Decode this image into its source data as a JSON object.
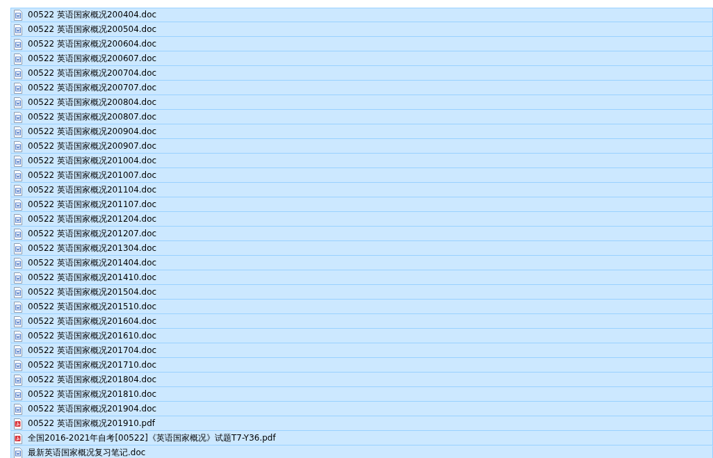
{
  "files": [
    {
      "name": "00522 英语国家概况200404.doc",
      "kind": "doc",
      "selected": true
    },
    {
      "name": "00522 英语国家概况200504.doc",
      "kind": "doc",
      "selected": true
    },
    {
      "name": "00522 英语国家概况200604.doc",
      "kind": "doc",
      "selected": true
    },
    {
      "name": "00522 英语国家概况200607.doc",
      "kind": "doc",
      "selected": true
    },
    {
      "name": "00522 英语国家概况200704.doc",
      "kind": "doc",
      "selected": true
    },
    {
      "name": "00522 英语国家概况200707.doc",
      "kind": "doc",
      "selected": true
    },
    {
      "name": "00522 英语国家概况200804.doc",
      "kind": "doc",
      "selected": true
    },
    {
      "name": "00522 英语国家概况200807.doc",
      "kind": "doc",
      "selected": true
    },
    {
      "name": "00522 英语国家概况200904.doc",
      "kind": "doc",
      "selected": true
    },
    {
      "name": "00522 英语国家概况200907.doc",
      "kind": "doc",
      "selected": true
    },
    {
      "name": "00522 英语国家概况201004.doc",
      "kind": "doc",
      "selected": true
    },
    {
      "name": "00522 英语国家概况201007.doc",
      "kind": "doc",
      "selected": true
    },
    {
      "name": "00522 英语国家概况201104.doc",
      "kind": "doc",
      "selected": true
    },
    {
      "name": "00522 英语国家概况201107.doc",
      "kind": "doc",
      "selected": true
    },
    {
      "name": "00522 英语国家概况201204.doc",
      "kind": "doc",
      "selected": true
    },
    {
      "name": "00522 英语国家概况201207.doc",
      "kind": "doc",
      "selected": true
    },
    {
      "name": "00522 英语国家概况201304.doc",
      "kind": "doc",
      "selected": true
    },
    {
      "name": "00522 英语国家概况201404.doc",
      "kind": "doc",
      "selected": true
    },
    {
      "name": "00522 英语国家概况201410.doc",
      "kind": "doc",
      "selected": true
    },
    {
      "name": "00522 英语国家概况201504.doc",
      "kind": "doc",
      "selected": true
    },
    {
      "name": "00522 英语国家概况201510.doc",
      "kind": "doc",
      "selected": true
    },
    {
      "name": "00522 英语国家概况201604.doc",
      "kind": "doc",
      "selected": true
    },
    {
      "name": "00522 英语国家概况201610.doc",
      "kind": "doc",
      "selected": true
    },
    {
      "name": "00522 英语国家概况201704.doc",
      "kind": "doc",
      "selected": true
    },
    {
      "name": "00522 英语国家概况201710.doc",
      "kind": "doc",
      "selected": true
    },
    {
      "name": "00522 英语国家概况201804.doc",
      "kind": "doc",
      "selected": true
    },
    {
      "name": "00522 英语国家概况201810.doc",
      "kind": "doc",
      "selected": true
    },
    {
      "name": "00522 英语国家概况201904.doc",
      "kind": "doc",
      "selected": true
    },
    {
      "name": "00522 英语国家概况201910.pdf",
      "kind": "pdf",
      "selected": true
    },
    {
      "name": "全国2016-2021年自考[00522]《英语国家概况》试题T7-Y36.pdf",
      "kind": "pdf",
      "selected": true
    },
    {
      "name": "最新英语国家概况复习笔记.doc",
      "kind": "doc",
      "selected": true
    }
  ]
}
